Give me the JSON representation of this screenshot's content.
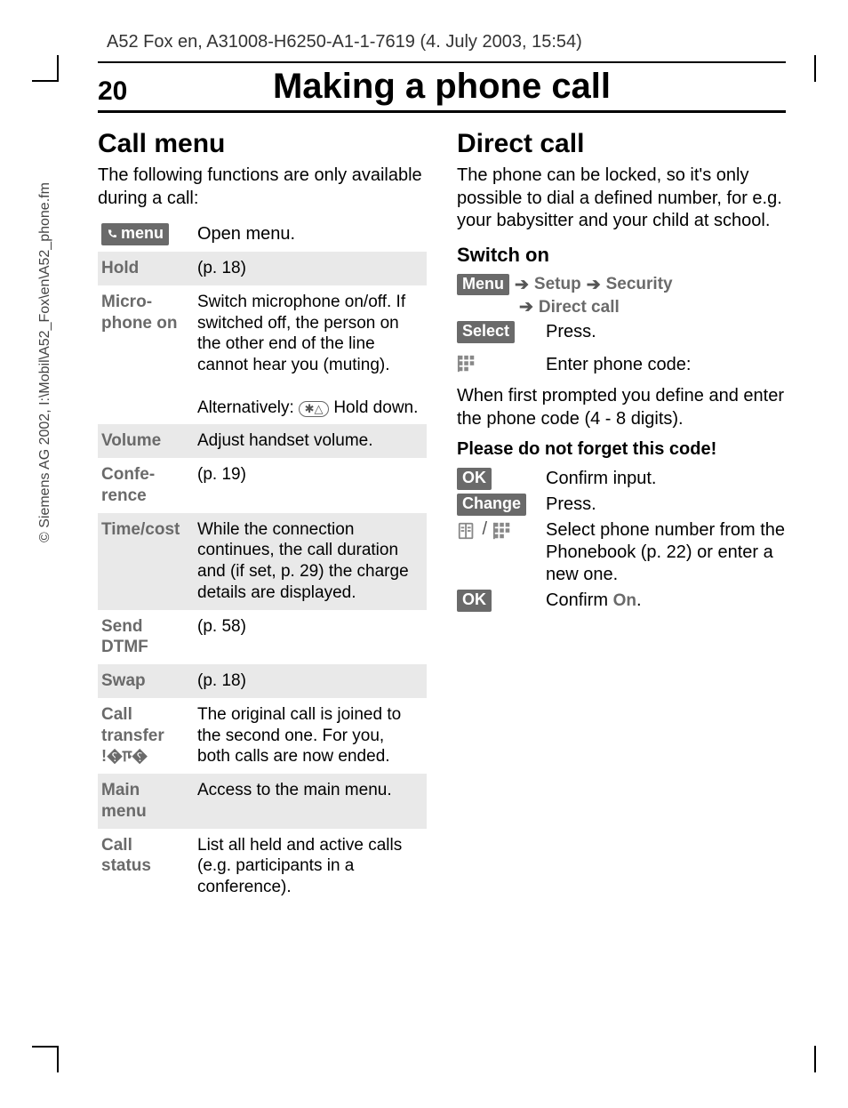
{
  "header": "A52 Fox en, A31008-H6250-A1-1-7619 (4. July 2003, 15:54)",
  "page_number": "20",
  "page_title": "Making a phone call",
  "copyright": "© Siemens AG 2002, I:\\Mobil\\A52_Fox\\en\\A52_phone.fm",
  "left": {
    "heading": "Call menu",
    "intro": "The following functions are only available during a call:",
    "menu_btn": "menu",
    "menu_desc": "Open menu.",
    "rows": [
      {
        "k": "Hold",
        "v": "(p. 18)"
      },
      {
        "k": "Micro­phone on",
        "v": "Switch microphone on/off. If switched off, the person on the other end of the line cannot hear you (muting).",
        "v2a": "Alternatively: ",
        "v2b": " Hold down."
      },
      {
        "k": "Volume",
        "v": "Adjust handset volume."
      },
      {
        "k": "Confe­rence",
        "v": "(p. 19)"
      },
      {
        "k": "Time/cost",
        "v": "While the connection continues, the call duration and (if set, p. 29) the charge details are displayed."
      },
      {
        "k": "Send DTMF",
        "v": "(p. 58)"
      },
      {
        "k": "Swap",
        "v": "(p. 18)"
      },
      {
        "k": "Call transfer",
        "v": "The original call is joined to the second one. For you, both calls are now ended.",
        "provider": true
      },
      {
        "k": "Main menu",
        "v": "Access to the main menu."
      },
      {
        "k": "Call status",
        "v": "List all held and active calls (e.g. participants in a conference)."
      }
    ]
  },
  "right": {
    "heading": "Direct call",
    "intro": "The phone can be locked, so it's only possible to dial a defined number, for e.g. your babysitter and your child at school.",
    "switch_on": "Switch on",
    "path": {
      "menu": "Menu",
      "a": "Setup",
      "b": "Security",
      "c": "Direct call"
    },
    "select_btn": "Select",
    "select_txt": "Press.",
    "enter_code": "Enter phone code:",
    "prompt1": "When first prompted you define and enter the phone code (4 - 8 digits).",
    "prompt2": "Please do not forget this code!",
    "ok_btn": "OK",
    "ok1_txt": "Confirm input.",
    "change_btn": "Change",
    "change_txt": "Press.",
    "select_num": "Select phone number from the Phonebook (p. 22) or enter a new one.",
    "ok2a": "Confirm ",
    "on_word": "On",
    "ok2b": "."
  }
}
